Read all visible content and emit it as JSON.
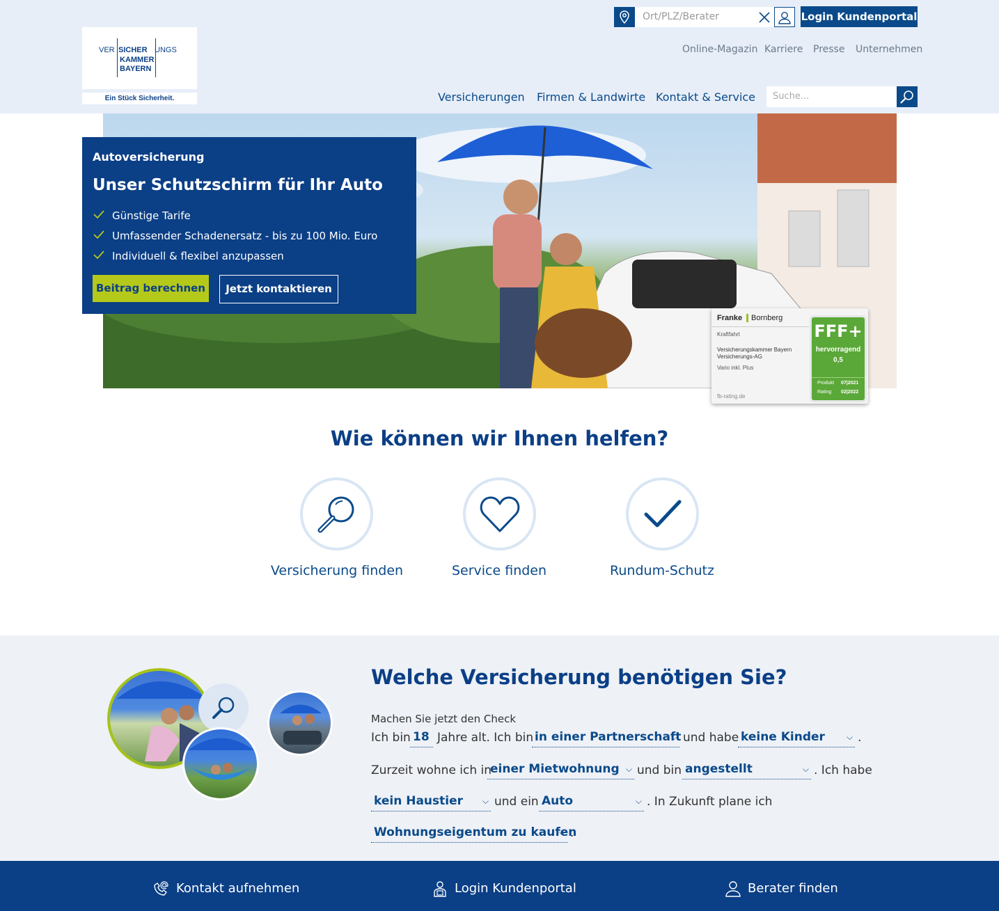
{
  "header": {
    "logo": {
      "line1_left": "VER",
      "line1_mid": "SICHER",
      "line1_right": "UNGS",
      "line2": "KAMMER",
      "line3": "BAYERN",
      "tagline": "Ein Stück Sicherheit."
    },
    "location_search_placeholder": "Ort/PLZ/Berater",
    "login_button": "Login Kundenportal",
    "meta_links": [
      "Online-Magazin",
      "Karriere",
      "Presse",
      "Unternehmen"
    ],
    "main_nav": [
      "Versicherungen",
      "Firmen & Landwirte",
      "Kontakt & Service"
    ],
    "search_placeholder": "Suche..."
  },
  "hero": {
    "kicker": "Autoversicherung",
    "title": "Unser Schutzschirm für Ihr Auto",
    "bullets": [
      "Günstige Tarife",
      "Umfassender Schadenersatz - bis zu 100 Mio. Euro",
      "Individuell & flexibel anzupassen"
    ],
    "primary_button": "Beitrag berechnen",
    "secondary_button": "Jetzt kontaktieren",
    "rating_badge": {
      "brand_left": "Franke",
      "brand_right": "Bornberg",
      "category": "Kraftfahrt",
      "company_line1": "Versicherungskammer Bayern",
      "company_line2": "Versicherungs-AG",
      "product": "Vario inkl. Plus",
      "url": "fb-rating.de",
      "grade": "FFF+",
      "grade_label": "hervorragend",
      "grade_value": "0,5",
      "produkt_label": "Produkt",
      "produkt_date": "07|2021",
      "rating_label": "Rating",
      "rating_date": "02|2022"
    }
  },
  "help": {
    "title": "Wie können wir Ihnen helfen?",
    "items": [
      {
        "label": "Versicherung finden",
        "icon": "magnifier-icon"
      },
      {
        "label": "Service finden",
        "icon": "heart-icon"
      },
      {
        "label": "Rundum-Schutz",
        "icon": "checkmark-icon"
      }
    ]
  },
  "check": {
    "title": "Welche Versicherung benötigen Sie?",
    "intro": "Machen Sie jetzt den Check",
    "text_ich_bin": "Ich bin",
    "age": "18",
    "text_jahre": "Jahre alt. Ich bin",
    "relationship": "in einer Partnerschaft",
    "text_und_habe": "und habe",
    "children": "keine Kinder",
    "dot1": ".",
    "text_zurzeit": "Zurzeit wohne ich in",
    "housing": "einer Mietwohnung",
    "text_und_bin": "und bin",
    "employment": "angestellt",
    "text_ich_habe": ". Ich habe",
    "pet": "kein Haustier",
    "text_und_ein": "und ein",
    "vehicle": "Auto",
    "text_zukunft": ". In Zukunft plane ich",
    "plan": "Wohnungseigentum zu kaufen",
    "dot2": "."
  },
  "footer": {
    "items": [
      {
        "label": "Kontakt aufnehmen",
        "icon": "phone-at-icon"
      },
      {
        "label": "Login Kundenportal",
        "icon": "login-portal-icon"
      },
      {
        "label": "Berater finden",
        "icon": "person-icon"
      }
    ]
  },
  "colors": {
    "brand_blue": "#0b3f86",
    "accent_green": "#b5c91a",
    "header_bg": "#e7eef8",
    "section_bg": "#eef1f6"
  }
}
